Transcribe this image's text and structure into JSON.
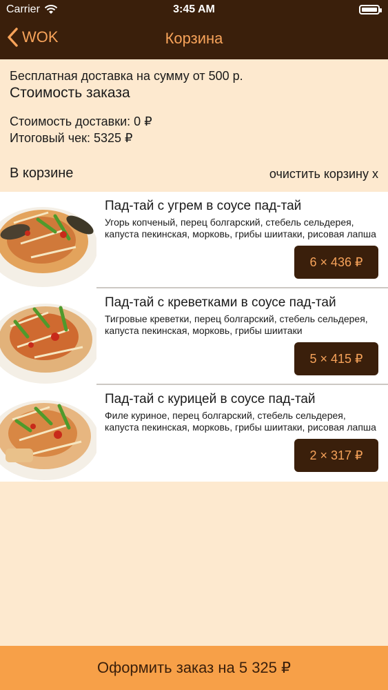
{
  "status_bar": {
    "carrier": "Carrier",
    "time": "3:45 AM"
  },
  "nav": {
    "back_label": "WOK",
    "title": "Корзина"
  },
  "summary": {
    "delivery_note": "Бесплатная доставка на сумму от 500 р.",
    "order_cost_label": "Стоимость заказа",
    "delivery_cost": "Стоимость доставки: 0 ₽",
    "total": "Итоговый чек: 5325 ₽"
  },
  "cart": {
    "title": "В корзине",
    "clear_label": "очистить корзину x",
    "items": [
      {
        "name": "Пад-тай с угрем в соусе пад-тай",
        "description": "Угорь копченый, перец болгарский, стебель сельдерея, капуста пекинская, морковь, грибы шиитаки, рисовая лапша",
        "price": "6 × 436 ₽"
      },
      {
        "name": "Пад-тай с креветками в соусе пад-тай",
        "description": "Тигровые креветки, перец болгарский, стебель сельдерея, капуста пекинская, морковь, грибы шиитаки",
        "price": "5 × 415 ₽"
      },
      {
        "name": "Пад-тай с курицей в соусе пад-тай",
        "description": "Филе куриное, перец болгарский, стебель сельдерея, капуста пекинская, морковь, грибы шиитаки, рисовая лапша",
        "price": "2 × 317 ₽"
      }
    ]
  },
  "checkout": {
    "label": "Оформить заказ на 5 325 ₽"
  },
  "colors": {
    "accent": "#f7a35a",
    "dark": "#3a1f0b",
    "background": "#fde9cf",
    "checkout_bg": "#f7a048"
  }
}
